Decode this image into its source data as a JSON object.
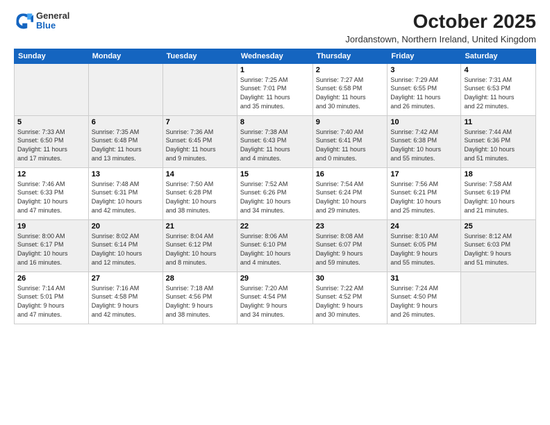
{
  "logo": {
    "general": "General",
    "blue": "Blue"
  },
  "title": "October 2025",
  "subtitle": "Jordanstown, Northern Ireland, United Kingdom",
  "days_header": [
    "Sunday",
    "Monday",
    "Tuesday",
    "Wednesday",
    "Thursday",
    "Friday",
    "Saturday"
  ],
  "weeks": [
    [
      {
        "day": "",
        "info": ""
      },
      {
        "day": "",
        "info": ""
      },
      {
        "day": "",
        "info": ""
      },
      {
        "day": "1",
        "info": "Sunrise: 7:25 AM\nSunset: 7:01 PM\nDaylight: 11 hours\nand 35 minutes."
      },
      {
        "day": "2",
        "info": "Sunrise: 7:27 AM\nSunset: 6:58 PM\nDaylight: 11 hours\nand 30 minutes."
      },
      {
        "day": "3",
        "info": "Sunrise: 7:29 AM\nSunset: 6:55 PM\nDaylight: 11 hours\nand 26 minutes."
      },
      {
        "day": "4",
        "info": "Sunrise: 7:31 AM\nSunset: 6:53 PM\nDaylight: 11 hours\nand 22 minutes."
      }
    ],
    [
      {
        "day": "5",
        "info": "Sunrise: 7:33 AM\nSunset: 6:50 PM\nDaylight: 11 hours\nand 17 minutes."
      },
      {
        "day": "6",
        "info": "Sunrise: 7:35 AM\nSunset: 6:48 PM\nDaylight: 11 hours\nand 13 minutes."
      },
      {
        "day": "7",
        "info": "Sunrise: 7:36 AM\nSunset: 6:45 PM\nDaylight: 11 hours\nand 9 minutes."
      },
      {
        "day": "8",
        "info": "Sunrise: 7:38 AM\nSunset: 6:43 PM\nDaylight: 11 hours\nand 4 minutes."
      },
      {
        "day": "9",
        "info": "Sunrise: 7:40 AM\nSunset: 6:41 PM\nDaylight: 11 hours\nand 0 minutes."
      },
      {
        "day": "10",
        "info": "Sunrise: 7:42 AM\nSunset: 6:38 PM\nDaylight: 10 hours\nand 55 minutes."
      },
      {
        "day": "11",
        "info": "Sunrise: 7:44 AM\nSunset: 6:36 PM\nDaylight: 10 hours\nand 51 minutes."
      }
    ],
    [
      {
        "day": "12",
        "info": "Sunrise: 7:46 AM\nSunset: 6:33 PM\nDaylight: 10 hours\nand 47 minutes."
      },
      {
        "day": "13",
        "info": "Sunrise: 7:48 AM\nSunset: 6:31 PM\nDaylight: 10 hours\nand 42 minutes."
      },
      {
        "day": "14",
        "info": "Sunrise: 7:50 AM\nSunset: 6:28 PM\nDaylight: 10 hours\nand 38 minutes."
      },
      {
        "day": "15",
        "info": "Sunrise: 7:52 AM\nSunset: 6:26 PM\nDaylight: 10 hours\nand 34 minutes."
      },
      {
        "day": "16",
        "info": "Sunrise: 7:54 AM\nSunset: 6:24 PM\nDaylight: 10 hours\nand 29 minutes."
      },
      {
        "day": "17",
        "info": "Sunrise: 7:56 AM\nSunset: 6:21 PM\nDaylight: 10 hours\nand 25 minutes."
      },
      {
        "day": "18",
        "info": "Sunrise: 7:58 AM\nSunset: 6:19 PM\nDaylight: 10 hours\nand 21 minutes."
      }
    ],
    [
      {
        "day": "19",
        "info": "Sunrise: 8:00 AM\nSunset: 6:17 PM\nDaylight: 10 hours\nand 16 minutes."
      },
      {
        "day": "20",
        "info": "Sunrise: 8:02 AM\nSunset: 6:14 PM\nDaylight: 10 hours\nand 12 minutes."
      },
      {
        "day": "21",
        "info": "Sunrise: 8:04 AM\nSunset: 6:12 PM\nDaylight: 10 hours\nand 8 minutes."
      },
      {
        "day": "22",
        "info": "Sunrise: 8:06 AM\nSunset: 6:10 PM\nDaylight: 10 hours\nand 4 minutes."
      },
      {
        "day": "23",
        "info": "Sunrise: 8:08 AM\nSunset: 6:07 PM\nDaylight: 9 hours\nand 59 minutes."
      },
      {
        "day": "24",
        "info": "Sunrise: 8:10 AM\nSunset: 6:05 PM\nDaylight: 9 hours\nand 55 minutes."
      },
      {
        "day": "25",
        "info": "Sunrise: 8:12 AM\nSunset: 6:03 PM\nDaylight: 9 hours\nand 51 minutes."
      }
    ],
    [
      {
        "day": "26",
        "info": "Sunrise: 7:14 AM\nSunset: 5:01 PM\nDaylight: 9 hours\nand 47 minutes."
      },
      {
        "day": "27",
        "info": "Sunrise: 7:16 AM\nSunset: 4:58 PM\nDaylight: 9 hours\nand 42 minutes."
      },
      {
        "day": "28",
        "info": "Sunrise: 7:18 AM\nSunset: 4:56 PM\nDaylight: 9 hours\nand 38 minutes."
      },
      {
        "day": "29",
        "info": "Sunrise: 7:20 AM\nSunset: 4:54 PM\nDaylight: 9 hours\nand 34 minutes."
      },
      {
        "day": "30",
        "info": "Sunrise: 7:22 AM\nSunset: 4:52 PM\nDaylight: 9 hours\nand 30 minutes."
      },
      {
        "day": "31",
        "info": "Sunrise: 7:24 AM\nSunset: 4:50 PM\nDaylight: 9 hours\nand 26 minutes."
      },
      {
        "day": "",
        "info": ""
      }
    ]
  ]
}
